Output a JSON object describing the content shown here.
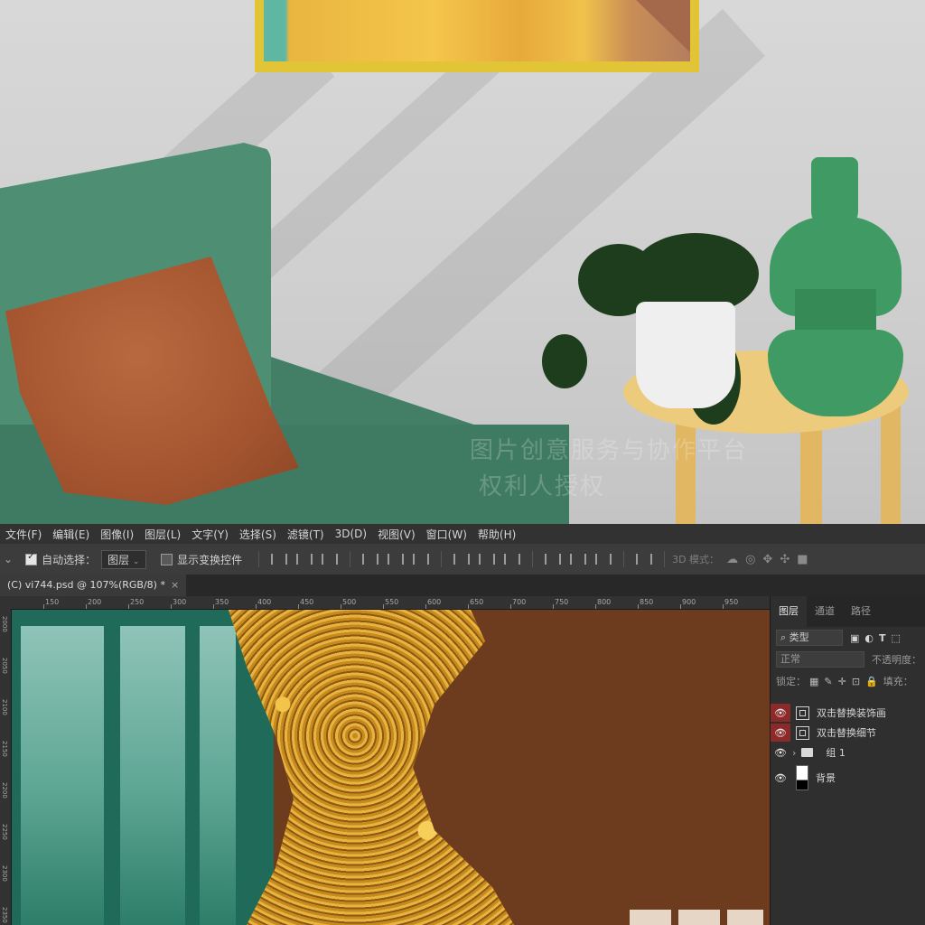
{
  "menu": [
    "文件(F)",
    "编辑(E)",
    "图像(I)",
    "图层(L)",
    "文字(Y)",
    "选择(S)",
    "滤镜(T)",
    "3D(D)",
    "视图(V)",
    "窗口(W)",
    "帮助(H)"
  ],
  "options": {
    "auto_select_label": "自动选择：",
    "auto_select_value": "图层",
    "show_transform_label": "显示变换控件",
    "mode_3d_label": "3D 模式："
  },
  "document_tab": {
    "title": "(C) vi744.psd @ 107%(RGB/8) *",
    "close": "×"
  },
  "ruler_h": [
    "150",
    "200",
    "250",
    "300",
    "350",
    "400",
    "450",
    "500",
    "550",
    "600",
    "650",
    "700",
    "750",
    "800",
    "850",
    "900",
    "950"
  ],
  "ruler_v": [
    "2000",
    "2050",
    "2100",
    "2150",
    "2200",
    "2250",
    "2300",
    "2350"
  ],
  "watermark": {
    "line1": "图片创意服务与协作平台",
    "line2": "权利人授权"
  },
  "layers_panel": {
    "tabs": [
      "图层",
      "通道",
      "路径"
    ],
    "filter_label": "类型",
    "blend_mode": "正常",
    "opacity_label": "不透明度：",
    "lock_label": "锁定：",
    "fill_label": "填充：",
    "layers": [
      {
        "name": "双击替换装饰画",
        "type": "smart",
        "eye_highlight": true
      },
      {
        "name": "双击替换细节",
        "type": "smart",
        "eye_highlight": true
      },
      {
        "name": "组 1",
        "type": "group",
        "eye_highlight": false
      },
      {
        "name": "背景",
        "type": "background",
        "eye_highlight": false
      }
    ]
  },
  "colors": {
    "menubar": "#323232",
    "panel": "#2f2f2f",
    "eye_highlight": "#8c2a2a",
    "canvas_green": "#1f6a58",
    "canvas_brown": "#6d3b1e"
  }
}
